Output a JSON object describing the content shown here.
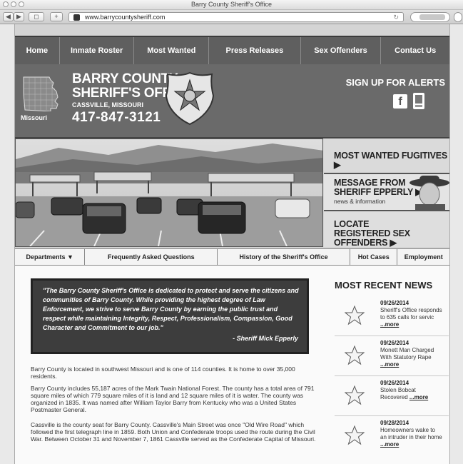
{
  "window": {
    "title": "Barry County Sheriff's Office"
  },
  "browser": {
    "url": "www.barrycountysheriff.com"
  },
  "nav": {
    "items": [
      "Home",
      "Inmate Roster",
      "Most Wanted",
      "Press Releases",
      "Sex Offenders",
      "Contact Us"
    ]
  },
  "header": {
    "state": "Missouri",
    "title_line1": "BARRY COUNTY",
    "title_line2": "SHERIFF'S OFFICE",
    "city": "CASSVILLE, MISSOURI",
    "phone": "417-847-3121",
    "alerts": "SIGN UP FOR ALERTS",
    "facebook_glyph": "f"
  },
  "side_panel": {
    "fugitives": "MOST WANTED FUGITIVES ▶",
    "message_line1": "MESSAGE FROM",
    "message_line2": "SHERIFF EPPERLY ▶",
    "message_sub": "news & information",
    "locate_line1": "LOCATE",
    "locate_line2": "REGISTERED SEX OFFENDERS ▶"
  },
  "subnav": {
    "items": [
      "Departments ▼",
      "Frequently Asked Questions",
      "History of the Sheriff's Office",
      "Hot Cases",
      "Employment"
    ]
  },
  "quote": {
    "text": "\"The Barry County Sheriff's Office is dedicated to protect and serve the citizens and communities of Barry County. While providing the highest degree of Law Enforcement, we strive to serve Barry County by earning the public trust and respect while maintaining Integrity, Respect, Professionalism, Compassion, Good Character and Commitment to our job.\"",
    "signature": "- Sheriff Mick Epperly"
  },
  "paragraphs": [
    "Barry County is located in southwest Missouri and is one of 114 counties. It is home to over 35,000 residents.",
    "Barry County includes 55,187 acres of the Mark Twain National Forest. The county has a total area of 791 square miles of which 779 square miles of it is land and 12 square miles of it is water. The county was organized in 1835. It was named after William Taylor Barry from Kentucky who was a United States Postmaster General.",
    "Cassville is the county seat for Barry County. Cassville's Main Street was once \"Old Wire Road\" which followed the first telegraph line in 1859. Both Union and Confederate troops used the route during the Civil War. Between October 31 and November 7, 1861 Cassville served as the Confederate Capital of Missouri."
  ],
  "news": {
    "heading": "MOST RECENT NEWS",
    "more": "...more",
    "items": [
      {
        "date": "09/26/2014",
        "title": "Sheriff's Office responds to 635 calls for servic"
      },
      {
        "date": "09/26/2014",
        "title": "Monett Man Charged With Statutory Rape"
      },
      {
        "date": "09/26/2014",
        "title": "Stolen Bobcat Recovered"
      },
      {
        "date": "09/28/2014",
        "title": "Homeowners wake to an intruder in their home"
      }
    ]
  }
}
